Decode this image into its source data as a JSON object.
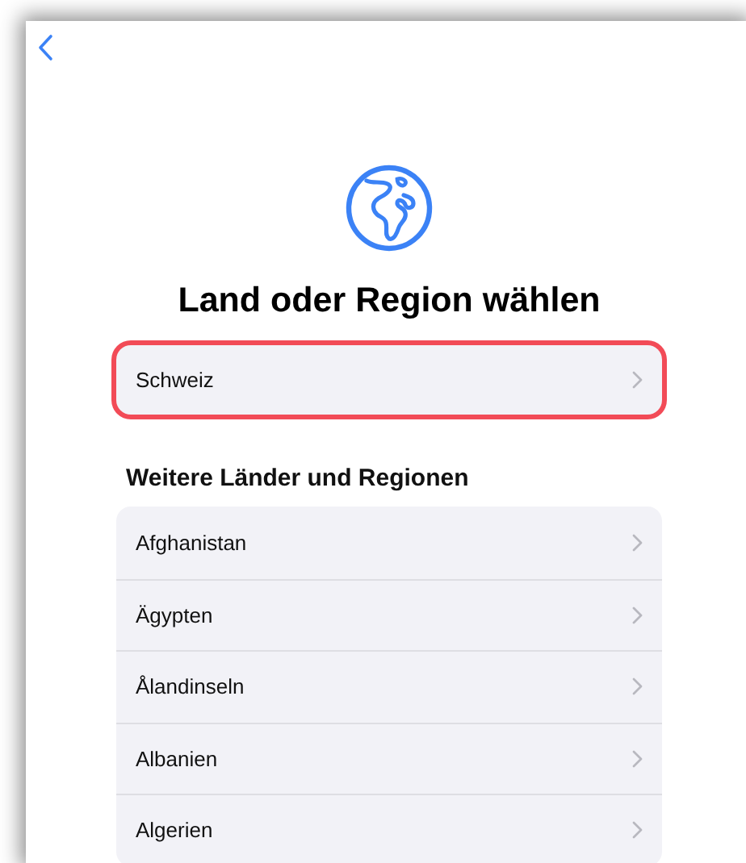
{
  "title": "Land oder Region wählen",
  "suggested": {
    "label": "Schweiz",
    "highlighted": true
  },
  "section_title": "Weitere Länder und Regionen",
  "countries": [
    {
      "label": "Afghanistan"
    },
    {
      "label": "Ägypten"
    },
    {
      "label": "Ålandinseln"
    },
    {
      "label": "Albanien"
    },
    {
      "label": "Algerien"
    }
  ]
}
